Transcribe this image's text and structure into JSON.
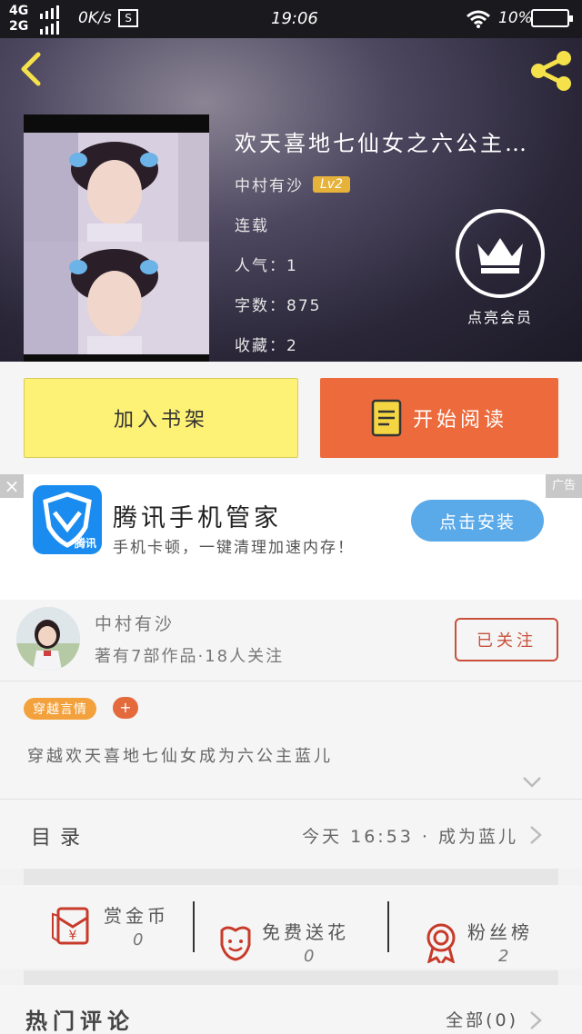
{
  "status_bar": {
    "network_top": "4G",
    "network_bottom": "2G",
    "speed": "0K/s",
    "box_icon_text": "S",
    "time": "19:06",
    "battery": "10%"
  },
  "book": {
    "title": "欢天喜地七仙女之六公主…",
    "author": "中村有沙",
    "level": "Lv2",
    "status": "连载",
    "popularity": "人气：1",
    "word_count": "字数：875",
    "favorites": "收藏：2",
    "vip_label": "点亮会员"
  },
  "actions": {
    "add_shelf": "加入书架",
    "start_read": "开始阅读"
  },
  "ad": {
    "title": "腾讯手机管家",
    "subtitle": "手机卡顿，一键清理加速内存！",
    "install": "点击安装",
    "tag": "广告",
    "close": "×",
    "logo_text": "腾讯",
    "brand_color": "#1a8cf0"
  },
  "author_card": {
    "name": "中村有沙",
    "stats": "著有7部作品·18人关注",
    "follow": "已关注"
  },
  "tags": {
    "genre": "穿越言情",
    "add": "+"
  },
  "description": "穿越欢天喜地七仙女成为六公主蓝儿",
  "toc": {
    "label": "目录",
    "latest": "今天 16:53 · 成为蓝儿"
  },
  "rewards": [
    {
      "label": "赏金币",
      "count": "0"
    },
    {
      "label": "免费送花",
      "count": "0"
    },
    {
      "label": "粉丝榜",
      "count": "2"
    }
  ],
  "comments": {
    "title": "热门评论",
    "all": "全部(0)"
  },
  "colors": {
    "yellow_button": "#fdf176",
    "orange_button": "#ec6a3c",
    "accent_red": "#c8503a",
    "tag_orange": "#f3a13c",
    "icon_yellow": "#f5e24a"
  }
}
